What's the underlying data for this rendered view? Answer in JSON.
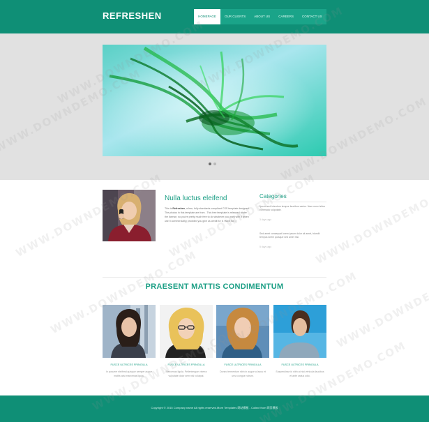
{
  "header": {
    "logo": "REFRESHEN",
    "nav": [
      {
        "label": "HOMEPAGE",
        "active": true
      },
      {
        "label": "OUR CLIENTS",
        "active": false
      },
      {
        "label": "ABOUT US",
        "active": false
      },
      {
        "label": "CAREERS",
        "active": false
      },
      {
        "label": "CONTACT US",
        "active": false
      }
    ]
  },
  "slider": {
    "slide_count": 2,
    "active_index": 0
  },
  "intro": {
    "title": "Nulla luctus eleifend",
    "text_pre": "This is ",
    "text_brand": "Refreshen",
    "text_post": ", a free, fully standards-compliant CSS template designed. The photos in this template are from . This free template is released under the license, so you're pretty much free to do whatever you want with it (even use it commercially) provided you give us credit for it. Have fun :)"
  },
  "categories": {
    "title": "Categories",
    "entries": [
      {
        "text": "Ipsum sed interdum tempor faucibus varius. Nam nunc tellus commodo vulputate.",
        "date": "3 days ago"
      },
      {
        "text": "Sed amet consequat lorem ipsum dolor sit amet, blandit tempus lorem quisque sed amet nisi.",
        "date": "5 days ago"
      }
    ]
  },
  "section": {
    "title": "PRAESENT MATTIS CONDIMENTUM"
  },
  "team": [
    {
      "name": "FUSCE ULTRICES FRINGILLA",
      "text": "In posuere eleifend quisque semper augue mattis wisi maecenas ligula."
    },
    {
      "name": "FUSCE ULTRICES FRINGILLA",
      "text": "Maecenas ligula. Pellentesque viverra vulputate dolor sem nisl volutpat."
    },
    {
      "name": "FUSCE ULTRICES FRINGILLA",
      "text": "Donec fermentum nibh in augue a lacus et urna congue rutrum."
    },
    {
      "name": "FUSCE ULTRICES FRINGILLA",
      "text": "Suspendisse id nibh at nisi vehicula faucibus et ante varius odio."
    }
  ],
  "footer": {
    "text": "Copyright © 2015 Company name All rights reserved.More Templates 网站模板 - Collect from 网页模板"
  },
  "watermark": "WWW.DOWNDEMO.COM",
  "colors": {
    "brand": "#0f8f76",
    "accent": "#1a9e84",
    "hero_bg": "#e1e1e1"
  }
}
